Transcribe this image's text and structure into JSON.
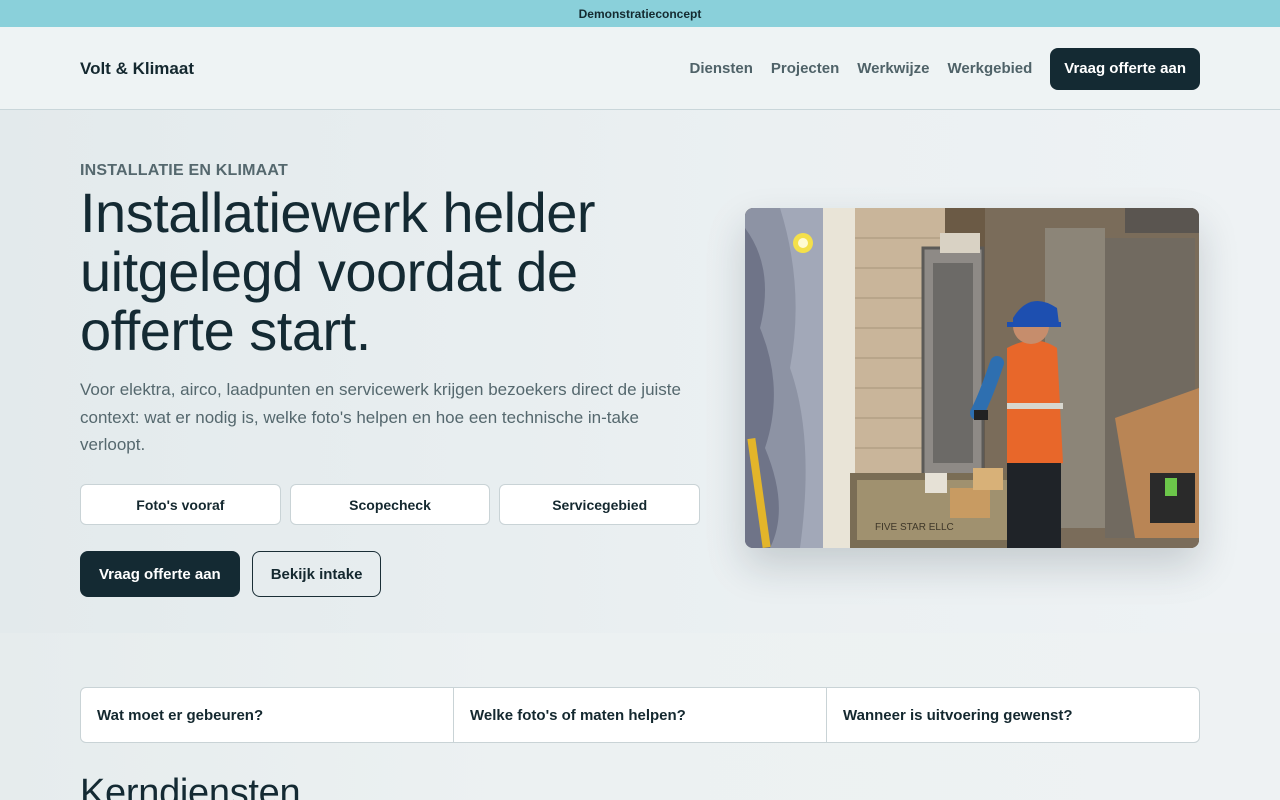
{
  "topbar": {
    "label": "Demonstratieconcept"
  },
  "header": {
    "brand": "Volt & Klimaat",
    "nav": [
      "Diensten",
      "Projecten",
      "Werkwijze",
      "Werkgebied"
    ],
    "cta_label": "Vraag offerte aan"
  },
  "hero": {
    "eyebrow": "INSTALLATIE EN KLIMAAT",
    "title": "Installatiewerk helder uitgelegd voordat de offerte start.",
    "lead": "Voor elektra, airco, laadpunten en servicewerk krijgen bezoekers direct de juiste context: wat er nodig is, welke foto's helpen en hoe een technische in-take verloopt.",
    "chips": [
      "Foto's vooraf",
      "Scopecheck",
      "Servicegebied"
    ],
    "primary_cta": "Vraag offerte aan",
    "secondary_cta": "Bekijk intake",
    "image_caption": "FIVE STAR ELLC"
  },
  "questions": [
    "Wat moet er gebeuren?",
    "Welke foto's of maten helpen?",
    "Wanneer is uitvoering gewenst?"
  ],
  "section": {
    "title": "Kerndiensten"
  },
  "colors": {
    "topbar": "#8ad0da",
    "primary_dark": "#142a33",
    "muted_text": "#55686e",
    "background": "#e9eef0"
  }
}
